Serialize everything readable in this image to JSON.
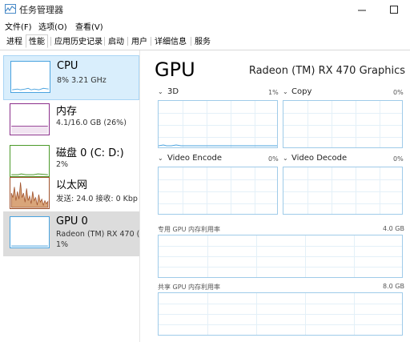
{
  "window": {
    "title": "任务管理器"
  },
  "menu": {
    "file": "文件(F)",
    "options": "选项(O)",
    "view": "查看(V)"
  },
  "tabs": [
    "进程",
    "性能",
    "应用历史记录",
    "启动",
    "用户",
    "详细信息",
    "服务"
  ],
  "sidebar": {
    "items": [
      {
        "title": "CPU",
        "line1": "8% 3.21 GHz",
        "color": "#4aa3df"
      },
      {
        "title": "内存",
        "line1": "4.1/16.0 GB (26%)",
        "color": "#8b2f8b"
      },
      {
        "title": "磁盘 0 (C: D:)",
        "line1": "2%",
        "color": "#4c9a2a"
      },
      {
        "title": "以太网",
        "line1": "发送: 24.0 接收: 0 Kbp",
        "color": "#a0522d"
      },
      {
        "title": "GPU 0",
        "line1": "Radeon (TM) RX 470 (",
        "line2": "1%",
        "color": "#4aa3df"
      }
    ]
  },
  "main": {
    "title": "GPU",
    "model": "Radeon (TM) RX 470 Graphics",
    "engines": [
      {
        "label": "3D",
        "pct": "1%"
      },
      {
        "label": "Copy",
        "pct": "0%"
      },
      {
        "label": "Video Encode",
        "pct": "0%"
      },
      {
        "label": "Video Decode",
        "pct": "0%"
      }
    ],
    "dedicated": {
      "label": "专用 GPU 内存利用率",
      "max": "4.0 GB"
    },
    "shared": {
      "label": "共享 GPU 内存利用率",
      "max": "8.0 GB"
    }
  },
  "colors": {
    "accent": "#4aa3df",
    "graph_border": "#9fcbe9",
    "selected_bg": "#d9eefc"
  }
}
